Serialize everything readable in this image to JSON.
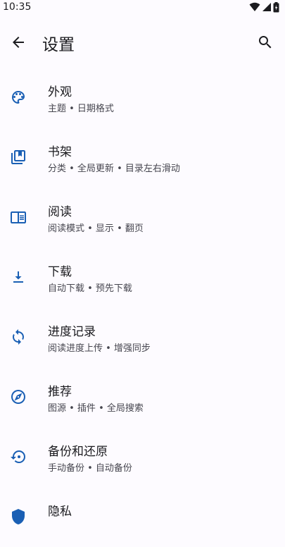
{
  "status": {
    "time": "10:35"
  },
  "appbar": {
    "title": "设置"
  },
  "colors": {
    "accent": "#1a5fb4",
    "background": "#fdfbff"
  },
  "items": [
    {
      "icon": "palette-icon",
      "label": "外观",
      "sub": "主题 • 日期格式"
    },
    {
      "icon": "book-shelf-icon",
      "label": "书架",
      "sub": "分类 • 全局更新 • 目录左右滑动"
    },
    {
      "icon": "reader-icon",
      "label": "阅读",
      "sub": "阅读模式 • 显示 • 翻页"
    },
    {
      "icon": "download-icon",
      "label": "下载",
      "sub": "自动下载 • 预先下载"
    },
    {
      "icon": "sync-icon",
      "label": "进度记录",
      "sub": "阅读进度上传 • 增强同步"
    },
    {
      "icon": "compass-icon",
      "label": "推荐",
      "sub": "图源 • 插件 • 全局搜索"
    },
    {
      "icon": "restore-icon",
      "label": "备份和还原",
      "sub": "手动备份 • 自动备份"
    },
    {
      "icon": "privacy-icon",
      "label": "隐私",
      "sub": ""
    }
  ]
}
